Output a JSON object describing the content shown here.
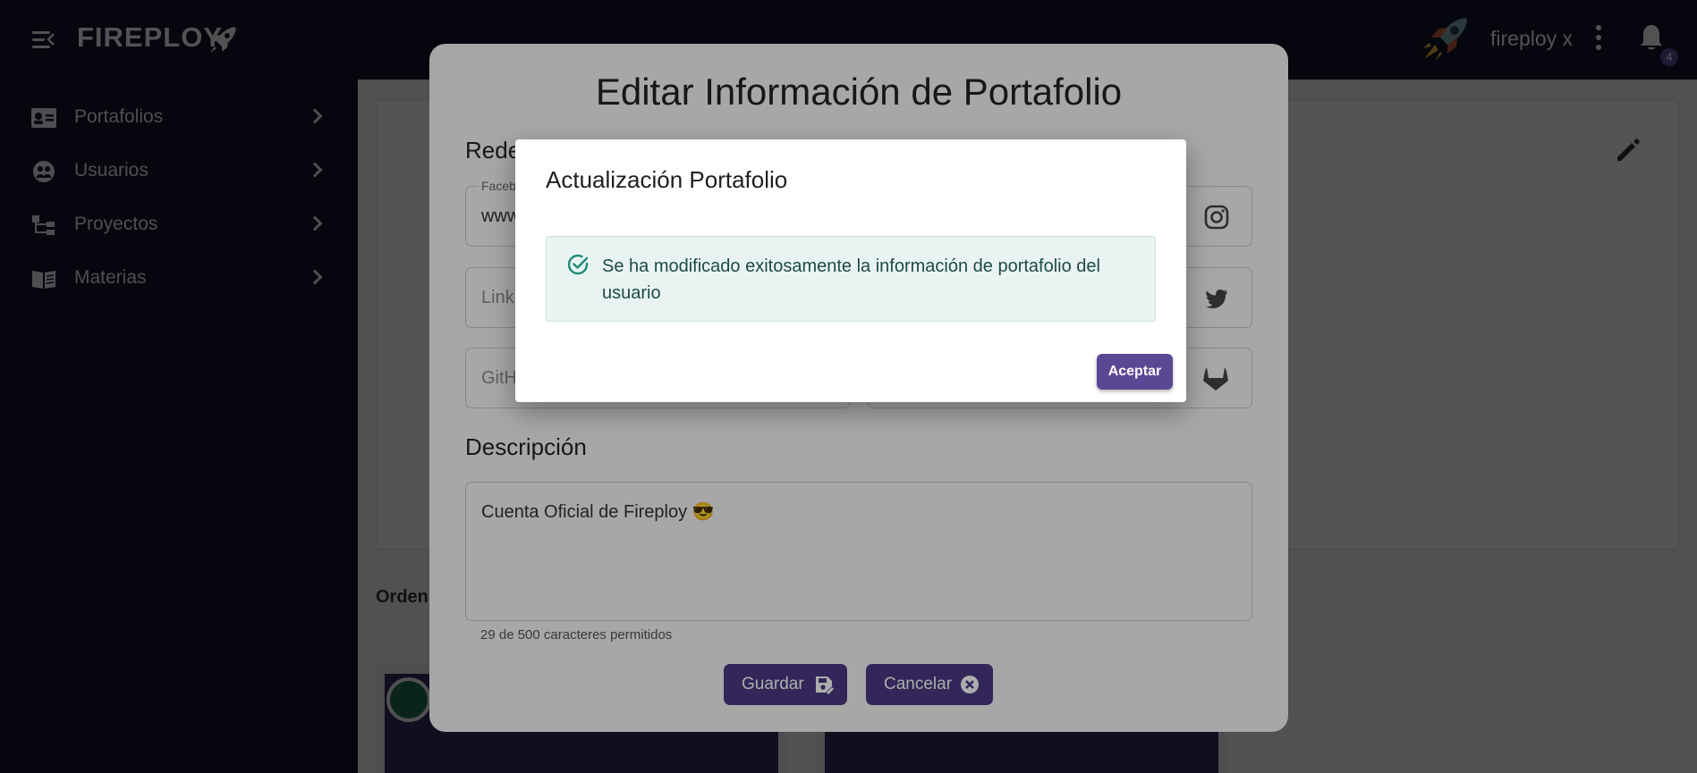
{
  "app": {
    "brand": "FIREPLOY",
    "username": "fireploy x",
    "notification_count": "4",
    "accent_color": "#4b3a82"
  },
  "sidebar": {
    "items": [
      {
        "label": "Portafolios",
        "icon": "id-card-icon"
      },
      {
        "label": "Usuarios",
        "icon": "user-group-icon"
      },
      {
        "label": "Proyectos",
        "icon": "project-tree-icon"
      },
      {
        "label": "Materias",
        "icon": "book-open-icon"
      }
    ]
  },
  "background": {
    "section_label": "Orden"
  },
  "edit_modal": {
    "title": "Editar Información de Portafolio",
    "social_heading": "Rede",
    "fields": {
      "facebook_label": "Faceb",
      "facebook_value": "www",
      "linkedin_placeholder": "Link",
      "github_placeholder": "GitH"
    },
    "description_heading": "Descripción",
    "description_value": "Cuenta Oficial de Fireploy 😎",
    "char_counter": "29 de 500 caracteres permitidos",
    "save_label": "Guardar",
    "cancel_label": "Cancelar"
  },
  "alert": {
    "title": "Actualización Portafolio",
    "message": "Se ha modificado exitosamente la información de portafolio del usuario",
    "accept_label": "Aceptar",
    "success_color": "#1e8a7a"
  }
}
